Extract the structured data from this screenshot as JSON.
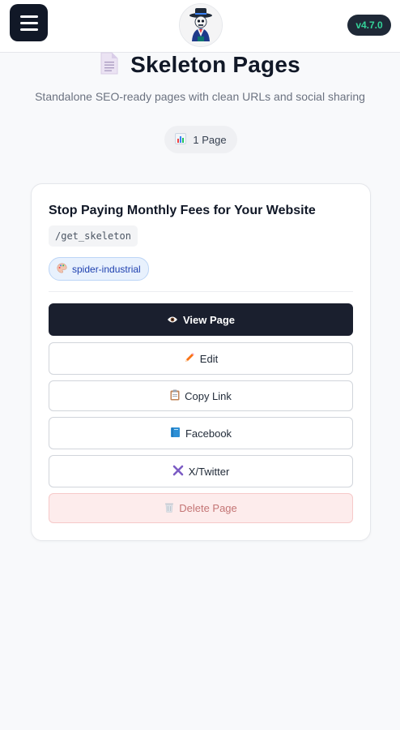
{
  "header": {
    "version": "v4.7.0"
  },
  "page": {
    "title": "Skeleton Pages",
    "subtitle": "Standalone SEO-ready pages with clean URLs and social sharing",
    "count_label": "1 Page"
  },
  "card": {
    "title": "Stop Paying Monthly Fees for Your Website",
    "slug": "/get_skeleton",
    "tag": "spider-industrial",
    "buttons": {
      "view": "View Page",
      "edit": "Edit",
      "copy": "Copy Link",
      "facebook": "Facebook",
      "twitter": "X/Twitter",
      "delete": "Delete Page"
    }
  },
  "icons": [
    "menu-icon",
    "skeleton-logo",
    "document-icon",
    "chart-icon",
    "palette-icon",
    "eye-icon",
    "pencil-icon",
    "clipboard-icon",
    "book-icon",
    "x-icon",
    "trash-icon"
  ],
  "colors": {
    "primary": "#1a1f2e",
    "version_text": "#34d399",
    "tag_bg": "#e8f1fd",
    "danger_bg": "#fdecec"
  }
}
